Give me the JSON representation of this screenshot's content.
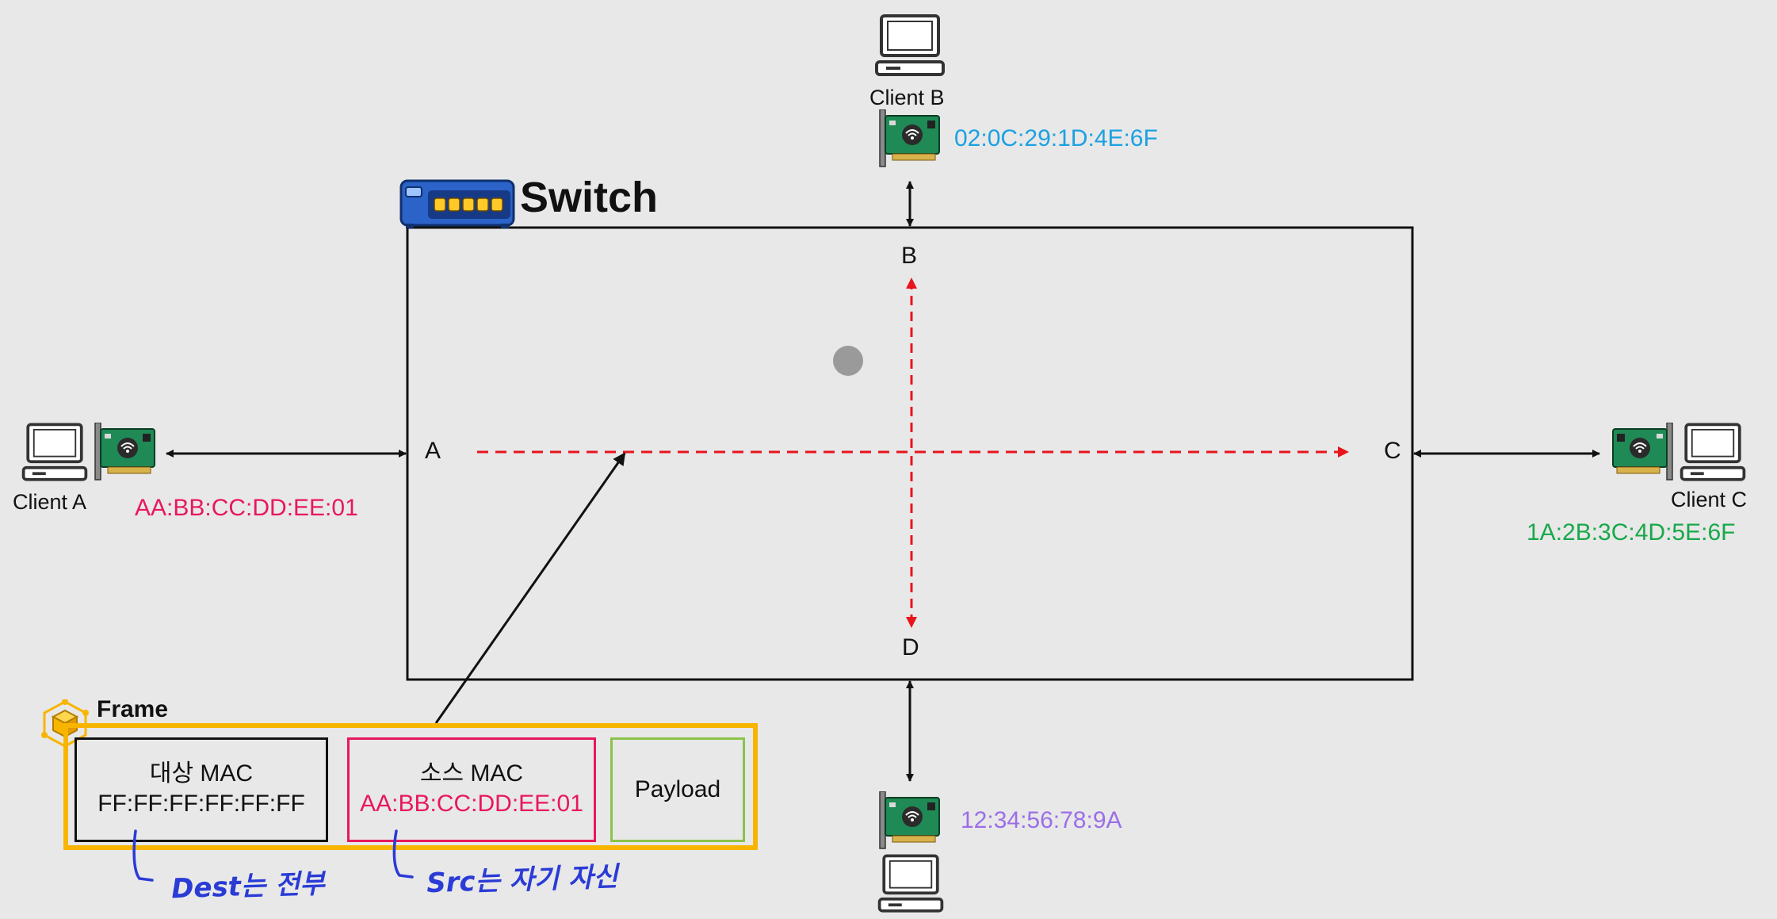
{
  "switch": {
    "title": "Switch",
    "ports": {
      "a": "A",
      "b": "B",
      "c": "C",
      "d": "D"
    }
  },
  "clients": {
    "a": {
      "label": "Client A",
      "mac": "AA:BB:CC:DD:EE:01"
    },
    "b": {
      "label": "Client B",
      "mac": "02:0C:29:1D:4E:6F"
    },
    "c": {
      "label": "Client C",
      "mac": "1A:2B:3C:4D:5E:6F"
    },
    "d": {
      "label": "",
      "mac": "12:34:56:78:9A"
    }
  },
  "frame": {
    "title": "Frame",
    "dest": {
      "label": "대상 MAC",
      "value": "FF:FF:FF:FF:FF:FF"
    },
    "src": {
      "label": "소스 MAC",
      "value": "AA:BB:CC:DD:EE:01"
    },
    "payload": "Payload"
  },
  "notes": {
    "dest": "Dest는 전부",
    "src": "Src는 자기 자신"
  },
  "colors": {
    "mac_a": "#e8175d",
    "mac_b": "#1ba1e2",
    "mac_c": "#18a84a",
    "mac_d": "#9b6ee8",
    "frame_border": "#f7b500",
    "src_border": "#e8175d",
    "payload_border": "#8bc34a",
    "flood_arrow": "#e8141b"
  },
  "icons": [
    "desktop-computer-icon",
    "network-card-icon",
    "network-switch-icon",
    "frame-cube-icon"
  ]
}
